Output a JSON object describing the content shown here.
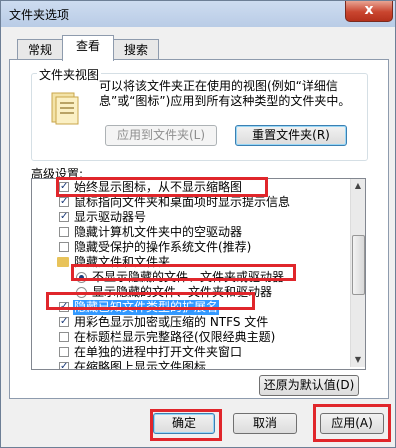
{
  "window": {
    "title": "文件夹选项",
    "close_label": "x"
  },
  "tabs": [
    {
      "label": "常规"
    },
    {
      "label": "查看"
    },
    {
      "label": "搜索"
    }
  ],
  "folder_views": {
    "title": "文件夹视图",
    "description": "可以将该文件夹正在使用的视图(例如“详细信息”或“图标”)应用到所有这种类型的文件夹中。",
    "apply_button": "应用到文件夹(L)",
    "reset_button": "重置文件夹(R)"
  },
  "advanced": {
    "label": "高级设置:",
    "items": [
      {
        "type": "checkbox",
        "checked": true,
        "label": "始终显示图标，从不显示缩略图"
      },
      {
        "type": "checkbox",
        "checked": true,
        "label": "鼠标指向文件夹和桌面项时显示提示信息"
      },
      {
        "type": "checkbox",
        "checked": true,
        "label": "显示驱动器号"
      },
      {
        "type": "checkbox",
        "checked": false,
        "label": "隐藏计算机文件夹中的空驱动器"
      },
      {
        "type": "checkbox",
        "checked": false,
        "label": "隐藏受保护的操作系统文件(推荐)"
      },
      {
        "type": "folder",
        "label": "隐藏文件和文件夹"
      },
      {
        "type": "radio",
        "checked": true,
        "label": "不显示隐藏的文件、文件夹或驱动器"
      },
      {
        "type": "radio",
        "checked": false,
        "label": "显示隐藏的文件、文件夹和驱动器"
      },
      {
        "type": "checkbox",
        "checked": true,
        "label": "隐藏已知文件类型的扩展名",
        "selected": true
      },
      {
        "type": "checkbox",
        "checked": true,
        "label": "用彩色显示加密或压缩的 NTFS 文件"
      },
      {
        "type": "checkbox",
        "checked": false,
        "label": "在标题栏显示完整路径(仅限经典主题)"
      },
      {
        "type": "checkbox",
        "checked": false,
        "label": "在单独的进程中打开文件夹窗口"
      },
      {
        "type": "checkbox",
        "checked": true,
        "label": "在缩略图上显示文件图标"
      }
    ],
    "restore_button": "还原为默认值(D)"
  },
  "footer": {
    "ok": "确定",
    "cancel": "取消",
    "apply": "应用(A)"
  },
  "colors": {
    "highlight_box": "#e0262b",
    "selection": "#3399ff"
  }
}
